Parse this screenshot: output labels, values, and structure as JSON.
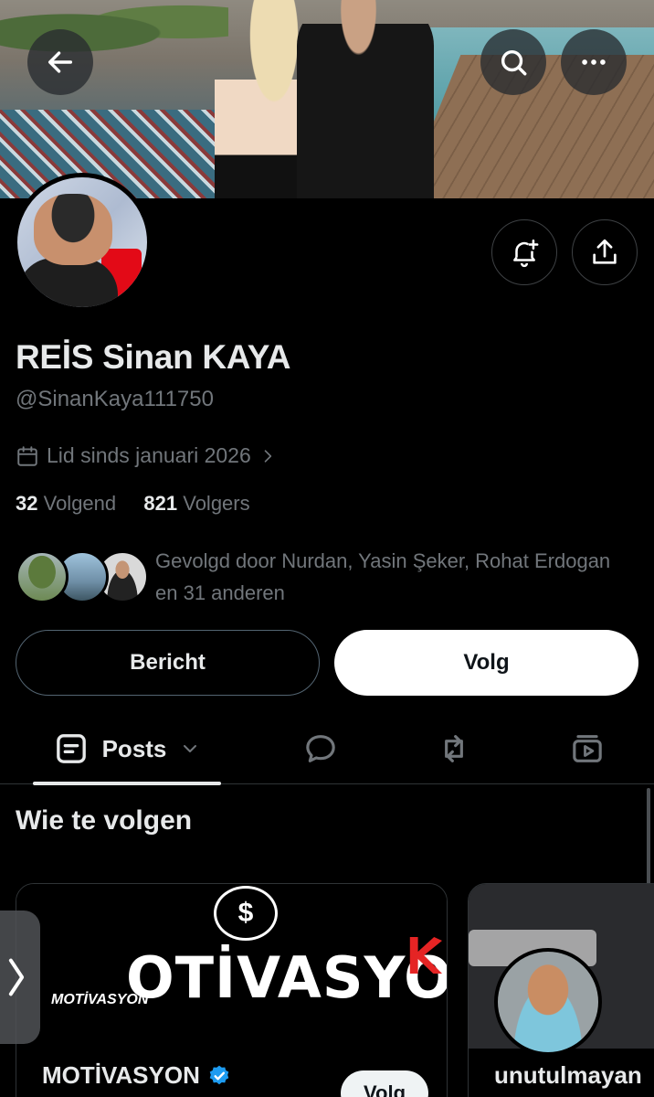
{
  "header": {
    "back_icon": "arrow-left-icon",
    "search_icon": "search-icon",
    "more_icon": "more-horizontal-icon"
  },
  "profile": {
    "display_name": "REİS Sinan KAYA",
    "handle": "@SinanKaya111750",
    "joined": "Lid sinds januari 2026",
    "following_count": "32",
    "following_label": "Volgend",
    "followers_count": "821",
    "followers_label": "Volgers",
    "followed_by_text": "Gevolgd door Nurdan, Yasin Şeker, Rohat Erdogan en 31 anderen"
  },
  "actions": {
    "message_label": "Bericht",
    "follow_label": "Volg",
    "notify_icon": "bell-plus-icon",
    "share_icon": "share-icon"
  },
  "tabs": [
    {
      "label": "Posts",
      "icon": "posts-icon",
      "active": true
    },
    {
      "label": "",
      "icon": "reply-icon"
    },
    {
      "label": "",
      "icon": "repost-icon"
    },
    {
      "label": "",
      "icon": "media-icon"
    }
  ],
  "who_to_follow": {
    "title": "Wie te volgen",
    "cards": [
      {
        "name": "MOTİVASYON",
        "verified": true,
        "follow_label": "Volg",
        "banner_text": "OTİVASYON",
        "banner_small_text": "MOTİVASYON"
      },
      {
        "name": "unutulmayan"
      }
    ]
  },
  "colors": {
    "background": "#000000",
    "text_primary": "#e7e9ea",
    "text_secondary": "#71767b",
    "verified_blue": "#1d9bf0"
  }
}
